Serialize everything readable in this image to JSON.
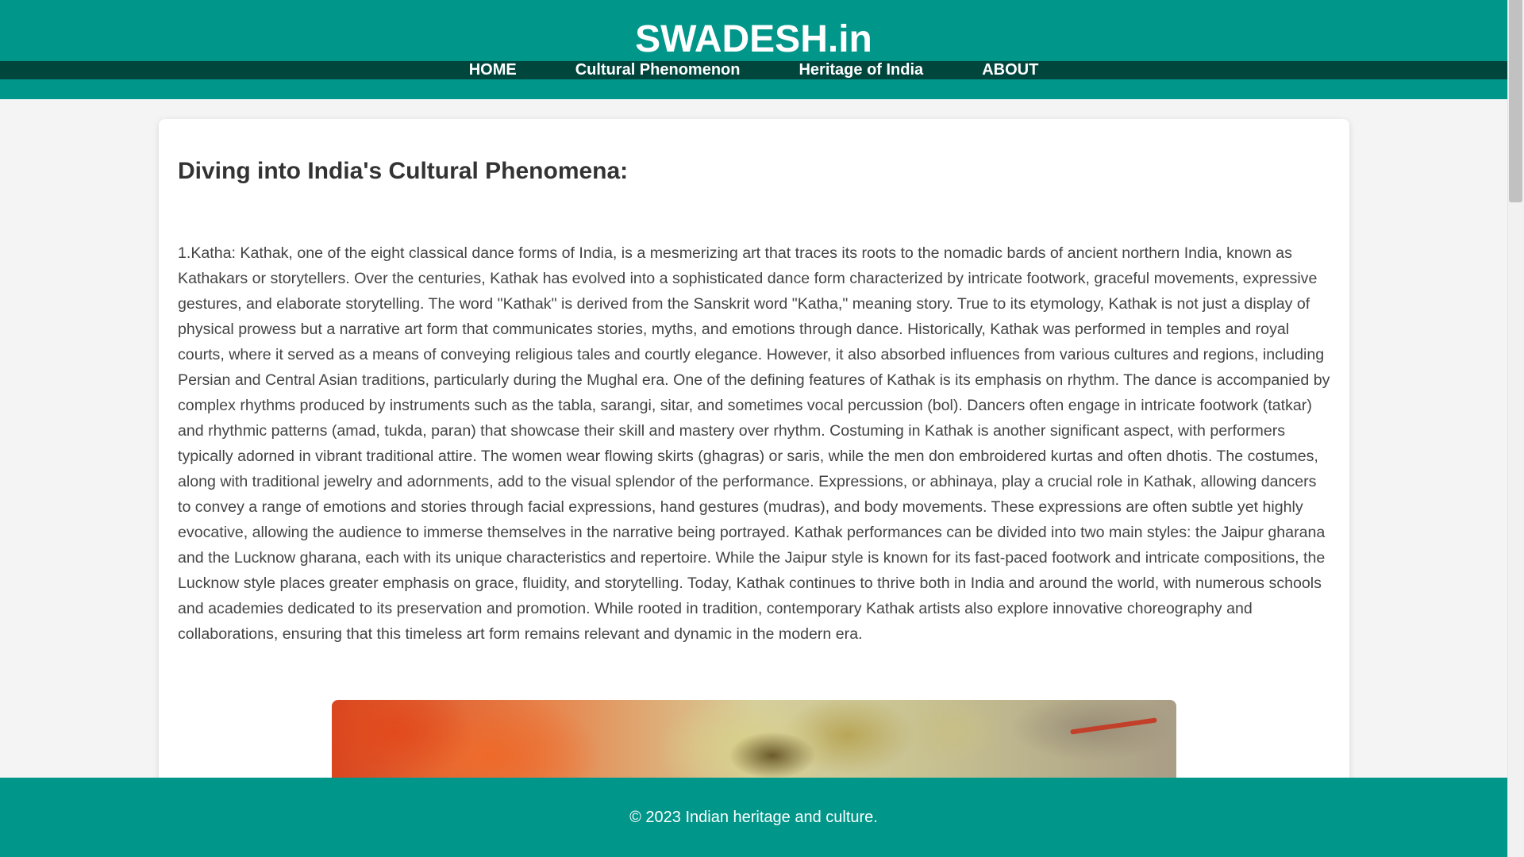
{
  "header": {
    "site_title": "SWADESH.in",
    "nav": [
      {
        "label": "HOME"
      },
      {
        "label": "Cultural Phenomenon"
      },
      {
        "label": "Heritage of India"
      },
      {
        "label": "ABOUT"
      }
    ]
  },
  "main": {
    "heading": "Diving into India's Cultural Phenomena:",
    "article": "1.Katha: Kathak, one of the eight classical dance forms of India, is a mesmerizing art that traces its roots to the nomadic bards of ancient northern India, known as Kathakars or storytellers. Over the centuries, Kathak has evolved into a sophisticated dance form characterized by intricate footwork, graceful movements, expressive gestures, and elaborate storytelling. The word \"Kathak\" is derived from the Sanskrit word \"Katha,\" meaning story. True to its etymology, Kathak is not just a display of physical prowess but a narrative art form that communicates stories, myths, and emotions through dance. Historically, Kathak was performed in temples and royal courts, where it served as a means of conveying religious tales and courtly elegance. However, it also absorbed influences from various cultures and regions, including Persian and Central Asian traditions, particularly during the Mughal era. One of the defining features of Kathak is its emphasis on rhythm. The dance is accompanied by complex rhythms produced by instruments such as the tabla, sarangi, sitar, and sometimes vocal percussion (bol). Dancers often engage in intricate footwork (tatkar) and rhythmic patterns (amad, tukda, paran) that showcase their skill and mastery over rhythm. Costuming in Kathak is another significant aspect, with performers typically adorned in vibrant traditional attire. The women wear flowing skirts (ghagras) or saris, while the men don embroidered kurtas and often dhotis. The costumes, along with traditional jewelry and adornments, add to the visual splendor of the performance. Expressions, or abhinaya, play a crucial role in Kathak, allowing dancers to convey a range of emotions and stories through facial expressions, hand gestures (mudras), and body movements. These expressions are often subtle yet highly evocative, allowing the audience to immerse themselves in the narrative being portrayed. Kathak performances can be divided into two main styles: the Jaipur gharana and the Lucknow gharana, each with its unique characteristics and repertoire. While the Jaipur style is known for its fast-paced footwork and intricate compositions, the Lucknow style places greater emphasis on grace, fluidity, and storytelling. Today, Kathak continues to thrive both in India and around the world, with numerous schools and academies dedicated to its preservation and promotion. While rooted in tradition, contemporary Kathak artists also explore innovative choreography and collaborations, ensuring that this timeless art form remains relevant and dynamic in the modern era."
  },
  "footer": {
    "text": "© 2023 Indian heritage and culture."
  },
  "colors": {
    "header_bg": "#00968a",
    "nav_bg": "#00463d",
    "footer_bg": "#00968a",
    "text": "#444444"
  }
}
